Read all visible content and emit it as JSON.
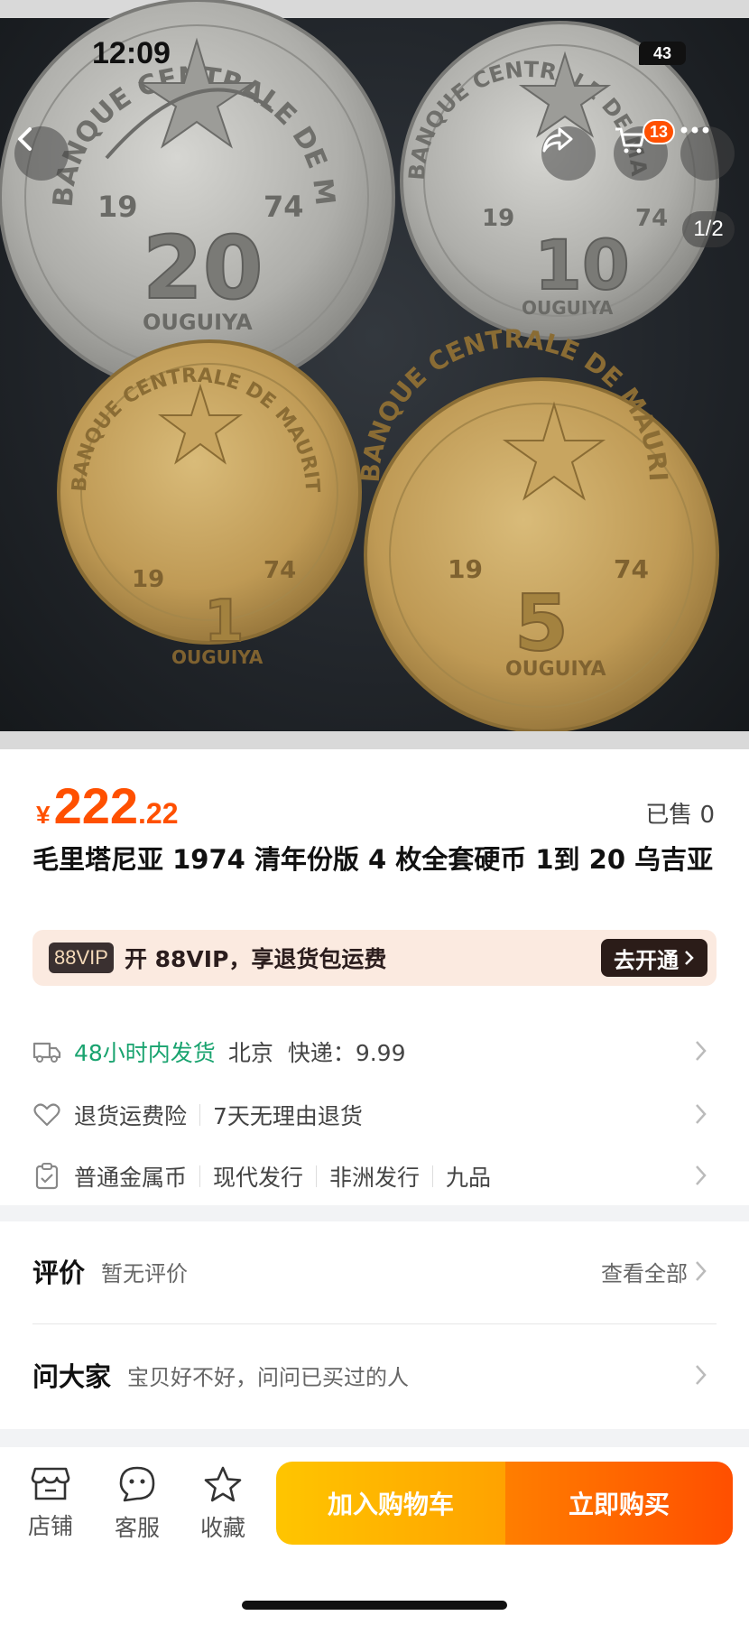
{
  "status_bar": {
    "time": "12:09",
    "battery": "43"
  },
  "gallery": {
    "pager": "1/2",
    "cart_count": "13",
    "coins": [
      {
        "denomination": "20",
        "year_left": "19",
        "year_right": "74",
        "unit": "OUGUIYA",
        "inscription": "BANQUE CENTRALE DE MAURITANIE",
        "metal": "silver"
      },
      {
        "denomination": "10",
        "year_left": "19",
        "year_right": "74",
        "unit": "OUGUIYA",
        "inscription": "BANQUE CENTRALE DE MAURITANIE",
        "metal": "silver"
      },
      {
        "denomination": "1",
        "year_left": "19",
        "year_right": "74",
        "unit": "OUGUIYA",
        "inscription": "BANQUE CENTRALE DE MAURITANIE",
        "metal": "brass"
      },
      {
        "denomination": "5",
        "year_left": "19",
        "year_right": "74",
        "unit": "OUGUIYA",
        "inscription": "BANQUE CENTRALE DE MAURITANIE",
        "metal": "brass"
      }
    ]
  },
  "product": {
    "currency": "¥",
    "price_int": "222",
    "price_dec": ".22",
    "sold": "已售 0",
    "title": "毛里塔尼亚 1974 清年份版 4 枚全套硬币 1到 20 乌吉亚"
  },
  "vip": {
    "logo": "88VIP",
    "text": "开 88VIP，享退货包运费",
    "button": "去开通"
  },
  "shipping": {
    "highlight": "48小时内发货",
    "origin": "北京",
    "express": "快递：9.99"
  },
  "service": {
    "item1": "退货运费险",
    "item2": "7天无理由退货"
  },
  "attributes": [
    "普通金属币",
    "现代发行",
    "非洲发行",
    "九品"
  ],
  "reviews": {
    "title": "评价",
    "subtitle": "暂无评价",
    "more": "查看全部"
  },
  "qa": {
    "title": "问大家",
    "subtitle": "宝贝好不好，问问已买过的人"
  },
  "bottom_bar": {
    "shop": "店铺",
    "service": "客服",
    "favorite": "收藏",
    "add_to_cart": "加入购物车",
    "buy_now": "立即购买"
  },
  "colors": {
    "accent": "#ff5000",
    "green": "#19a36f",
    "cart_yellow": "#ffb300"
  }
}
